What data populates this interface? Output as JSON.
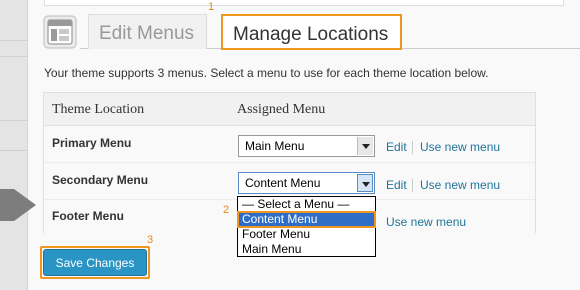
{
  "tabs": {
    "edit_label": "Edit Menus",
    "manage_label": "Manage Locations"
  },
  "markers": {
    "one": "1",
    "two": "2",
    "three": "3"
  },
  "intro_text": "Your theme supports 3 menus. Select a menu to use for each theme location below.",
  "table": {
    "col_location": "Theme Location",
    "col_menu": "Assigned Menu",
    "rows": [
      {
        "label": "Primary Menu",
        "selected": "Main Menu",
        "edit_link": "Edit",
        "new_link": "Use new menu"
      },
      {
        "label": "Secondary Menu",
        "selected": "Content Menu",
        "edit_link": "Edit",
        "new_link": "Use new menu"
      },
      {
        "label": "Footer Menu",
        "new_link": "Use new menu"
      }
    ]
  },
  "dropdown": {
    "options": [
      "— Select a Menu —",
      "Content Menu",
      "Footer Menu",
      "Main Menu"
    ],
    "highlighted": "Content Menu"
  },
  "save_label": "Save Changes",
  "colors": {
    "highlight": "#f0951f",
    "link": "#21759b",
    "button": "#2a95c5",
    "selected_option": "#2f6ec8"
  },
  "icons": {
    "screen": "menus-screen-icon"
  }
}
